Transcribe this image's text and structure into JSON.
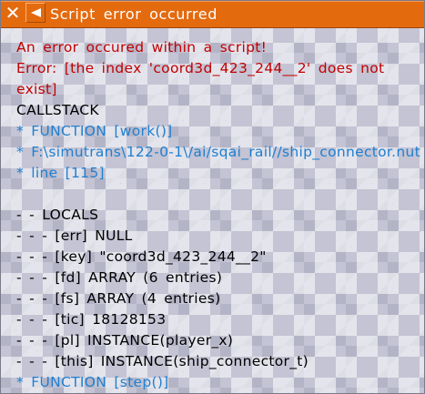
{
  "window": {
    "title": "Script error occurred",
    "close_icon": "close-x-icon",
    "pin_icon": "pin-triangle-icon"
  },
  "colors": {
    "titlebar": "#e46a0e",
    "error_text": "#c30000",
    "normal_text": "#000000",
    "callstack_text": "#1f7fcf"
  },
  "error": {
    "line1": "An error occured within a script!",
    "line2": "Error: [the index 'coord3d_423_244__2' does not",
    "line3": "exist]"
  },
  "callstack": {
    "header": "CALLSTACK",
    "function1": "* FUNCTION [work()]",
    "file1": "* F:\\simutrans\\122-0-1\\/ai/sqai_rail//ship_connector.nut",
    "line1": "* line [115]"
  },
  "locals": {
    "header": "- - LOCALS",
    "items": [
      "- - - [err] NULL",
      "- - - [key] \"coord3d_423_244__2\"",
      "- - - [fd] ARRAY (6 entries)",
      "- - - [fs] ARRAY (4 entries)",
      "- - - [tic] 18128153",
      "- - - [pl] INSTANCE(player_x)",
      "- - - [this] INSTANCE(ship_connector_t)"
    ]
  },
  "next_function": "* FUNCTION [step()]"
}
